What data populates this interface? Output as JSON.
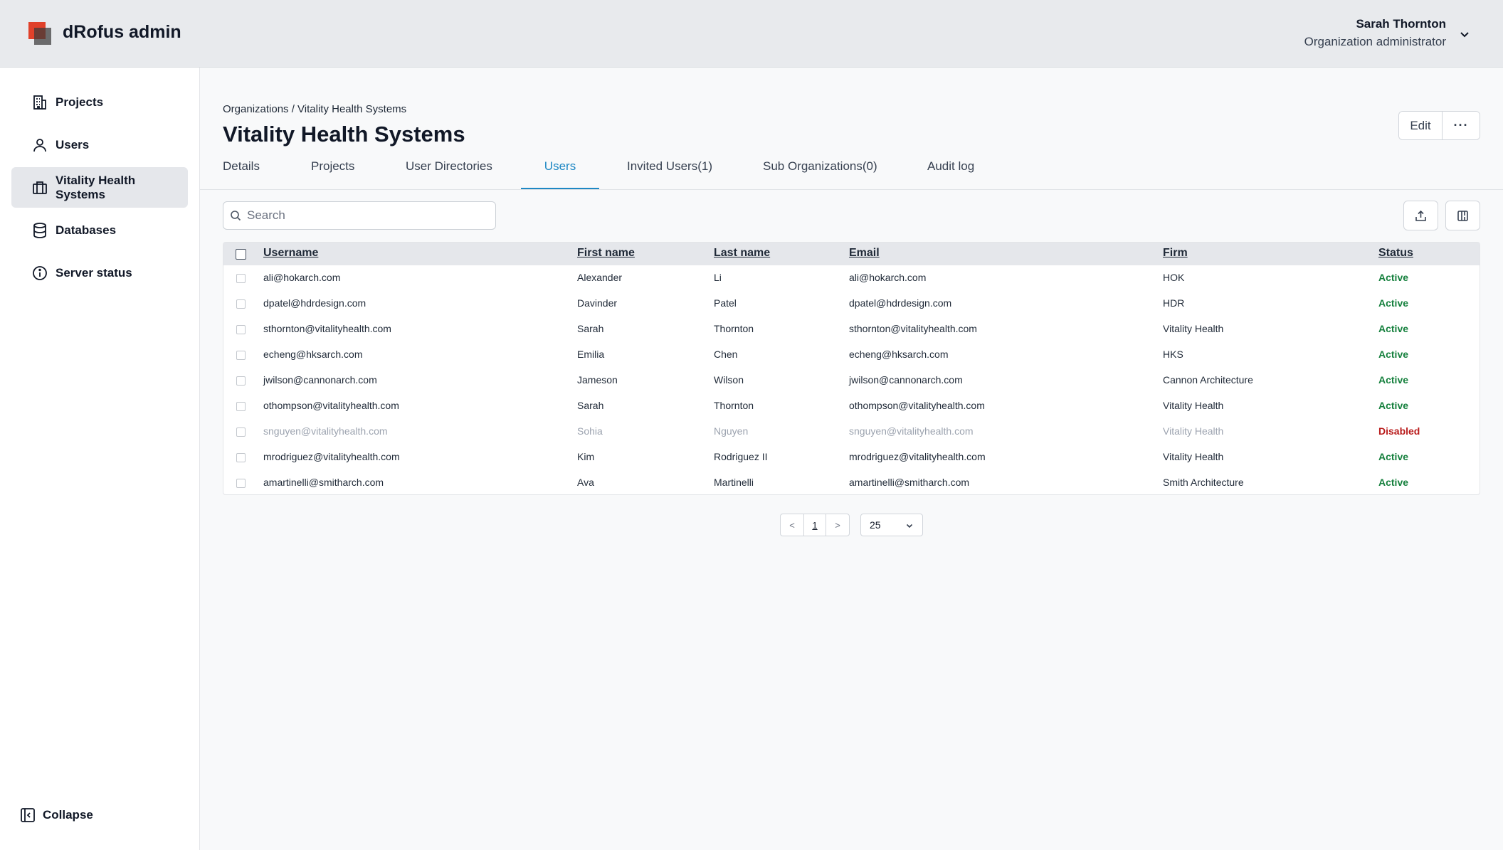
{
  "app": {
    "title": "dRofus admin"
  },
  "user": {
    "name": "Sarah Thornton",
    "role": "Organization administrator"
  },
  "sidebar": {
    "items": [
      {
        "label": "Projects",
        "icon": "building-icon"
      },
      {
        "label": "Users",
        "icon": "user-icon"
      },
      {
        "label": "Vitality Health Systems",
        "icon": "briefcase-icon",
        "active": true
      },
      {
        "label": "Databases",
        "icon": "database-icon"
      },
      {
        "label": "Server status",
        "icon": "info-icon"
      }
    ],
    "collapse_label": "Collapse"
  },
  "breadcrumb": "Organizations / Vitality Health Systems",
  "page_title": "Vitality Health Systems",
  "actions": {
    "edit_label": "Edit",
    "more_label": "···"
  },
  "tabs": [
    {
      "label": "Details"
    },
    {
      "label": "Projects"
    },
    {
      "label": "User Directories"
    },
    {
      "label": "Users",
      "active": true
    },
    {
      "label": "Invited Users(1)"
    },
    {
      "label": "Sub Organizations(0)"
    },
    {
      "label": "Audit log"
    }
  ],
  "search": {
    "placeholder": "Search",
    "value": ""
  },
  "table": {
    "columns": [
      "Username",
      "First name",
      "Last name",
      "Email",
      "Firm",
      "Status"
    ],
    "rows": [
      {
        "username": "ali@hokarch.com",
        "first": "Alexander",
        "last": "Li",
        "email": "ali@hokarch.com",
        "firm": "HOK",
        "status": "Active"
      },
      {
        "username": "dpatel@hdrdesign.com",
        "first": "Davinder",
        "last": "Patel",
        "email": "dpatel@hdrdesign.com",
        "firm": "HDR",
        "status": "Active"
      },
      {
        "username": "sthornton@vitalityhealth.com",
        "first": "Sarah",
        "last": "Thornton",
        "email": "sthornton@vitalityhealth.com",
        "firm": "Vitality Health",
        "status": "Active"
      },
      {
        "username": "echeng@hksarch.com",
        "first": "Emilia",
        "last": "Chen",
        "email": "echeng@hksarch.com",
        "firm": "HKS",
        "status": "Active"
      },
      {
        "username": "jwilson@cannonarch.com",
        "first": "Jameson",
        "last": "Wilson",
        "email": "jwilson@cannonarch.com",
        "firm": "Cannon Architecture",
        "status": "Active"
      },
      {
        "username": "othompson@vitalityhealth.com",
        "first": "Sarah",
        "last": "Thornton",
        "email": "othompson@vitalityhealth.com",
        "firm": "Vitality Health",
        "status": "Active"
      },
      {
        "username": "snguyen@vitalityhealth.com",
        "first": "Sohia",
        "last": "Nguyen",
        "email": "snguyen@vitalityhealth.com",
        "firm": "Vitality Health",
        "status": "Disabled"
      },
      {
        "username": "mrodriguez@vitalityhealth.com",
        "first": "Kim",
        "last": "Rodriguez II",
        "email": "mrodriguez@vitalityhealth.com",
        "firm": "Vitality Health",
        "status": "Active"
      },
      {
        "username": "amartinelli@smitharch.com",
        "first": "Ava",
        "last": "Martinelli",
        "email": "amartinelli@smitharch.com",
        "firm": "Smith Architecture",
        "status": "Active"
      }
    ]
  },
  "pagination": {
    "prev": "<",
    "current": "1",
    "next": ">",
    "page_size": "25"
  },
  "colors": {
    "accent": "#1e88c4",
    "active_status": "#15803d",
    "disabled_status": "#b91c1c",
    "brand": "#e0412a"
  }
}
